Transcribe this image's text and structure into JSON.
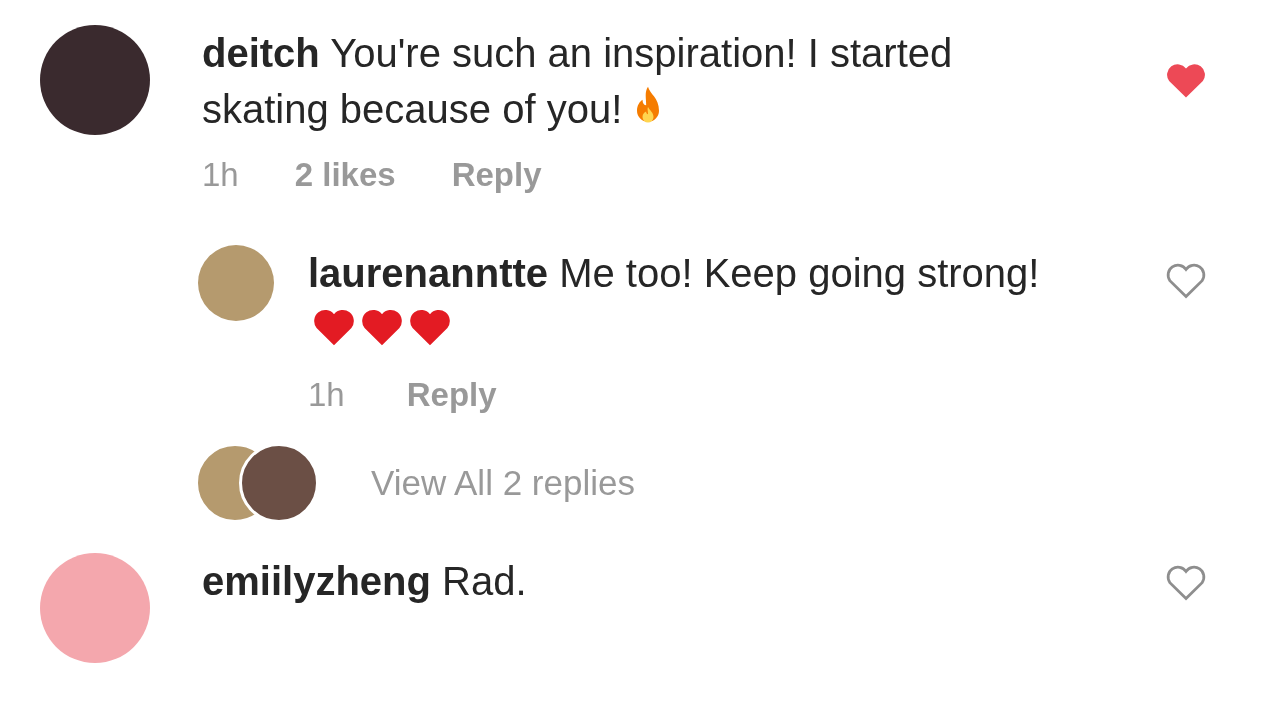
{
  "comments": [
    {
      "username": "deitch",
      "text": "You're such an inspiration! I started skating because of you!",
      "emoji": [
        {
          "kind": "fire"
        }
      ],
      "liked": true,
      "time": "1h",
      "likes": "2 likes",
      "reply": "Reply",
      "replies": [
        {
          "username": "laurenanntte",
          "text": "Me too! Keep going strong!",
          "emoji": [
            {
              "kind": "heart"
            },
            {
              "kind": "heart"
            },
            {
              "kind": "heart"
            }
          ],
          "liked": false,
          "time": "1h",
          "reply": "Reply"
        }
      ],
      "view_replies": "View All 2 replies"
    },
    {
      "username": "emiilyzheng",
      "text": "Rad.",
      "liked": false
    }
  ]
}
